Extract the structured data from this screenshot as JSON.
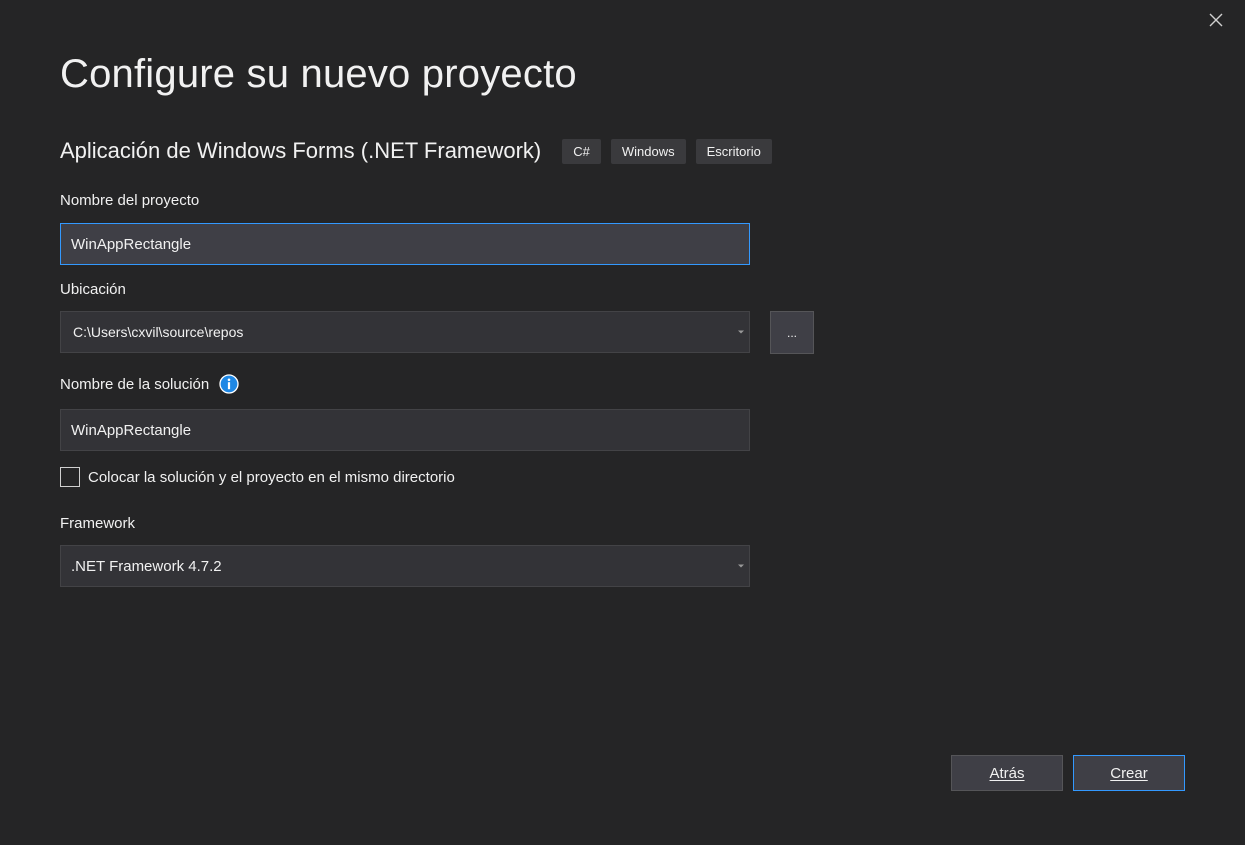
{
  "dialog": {
    "title": "Configure su nuevo proyecto",
    "template": {
      "name": "Aplicación de Windows Forms (.NET Framework)",
      "tags": [
        "C#",
        "Windows",
        "Escritorio"
      ]
    }
  },
  "project_name": {
    "label": "Nombre del proyecto",
    "value": "WinAppRectangle"
  },
  "location": {
    "label": "Ubicación",
    "value": "C:\\Users\\cxvil\\source\\repos",
    "browse_label": "..."
  },
  "solution_name": {
    "label": "Nombre de la solución",
    "value": "WinAppRectangle"
  },
  "same_directory": {
    "label": "Colocar la solución y el proyecto en el mismo directorio",
    "checked": false
  },
  "framework": {
    "label": "Framework",
    "value": ".NET Framework 4.7.2"
  },
  "buttons": {
    "back": "Atrás",
    "create": "Crear"
  },
  "icons": {
    "close": "close-icon",
    "info": "info-icon",
    "dropdown": "chevron-down-icon"
  },
  "colors": {
    "background": "#252526",
    "accent": "#3399ff",
    "field_bg": "#333337",
    "button_bg": "#3f3f46"
  }
}
